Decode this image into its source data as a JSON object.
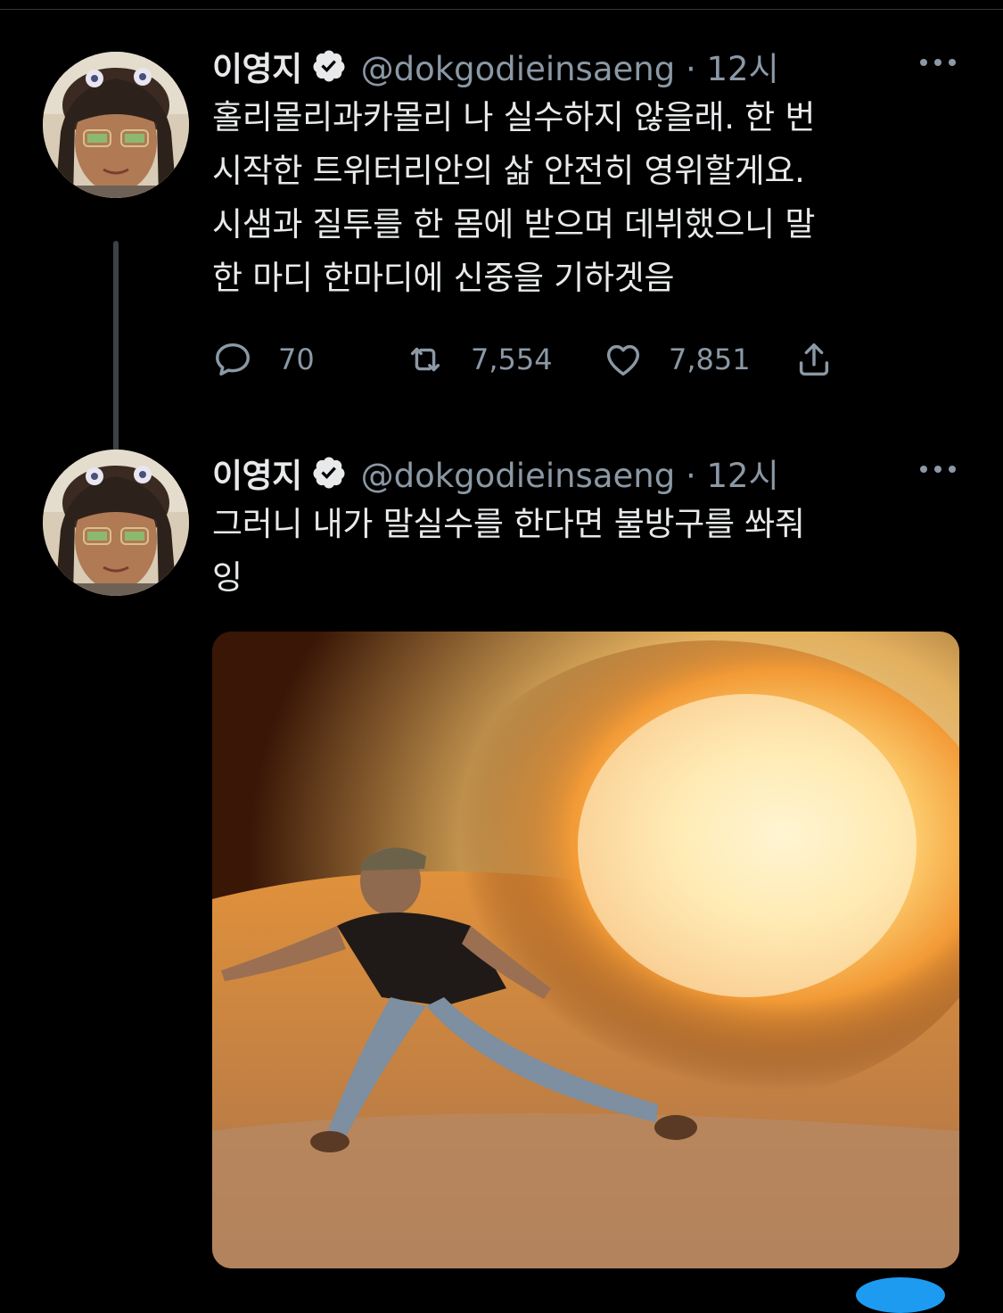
{
  "tweets": [
    {
      "author_name": "이영지",
      "handle_time": "@dokgodieinsaeng · 12시",
      "text": "홀리몰리과카몰리 나 실수하지 않을래. 한 번\n시작한 트위터리안의 삶 안전히 영위할게요.\n시샘과 질투를 한 몸에 받으며 데뷔했으니 말\n한 마디 한마디에 신중을 기하겟음",
      "reply_count": "70",
      "retweet_count": "7,554",
      "like_count": "7,851"
    },
    {
      "author_name": "이영지",
      "handle_time": "@dokgodieinsaeng · 12시",
      "text": "그러니 내가 말실수를 한다면 불방구를 쏴줘\n잉"
    }
  ],
  "colors": {
    "background": "#000000",
    "text_primary": "#e7e9ea",
    "text_secondary": "#8b98a5",
    "verified_badge": "#e7e9ea",
    "thread_line": "#3e4144"
  },
  "icons": [
    "verified-icon",
    "more-icon",
    "reply-icon",
    "retweet-icon",
    "like-icon",
    "share-icon"
  ]
}
